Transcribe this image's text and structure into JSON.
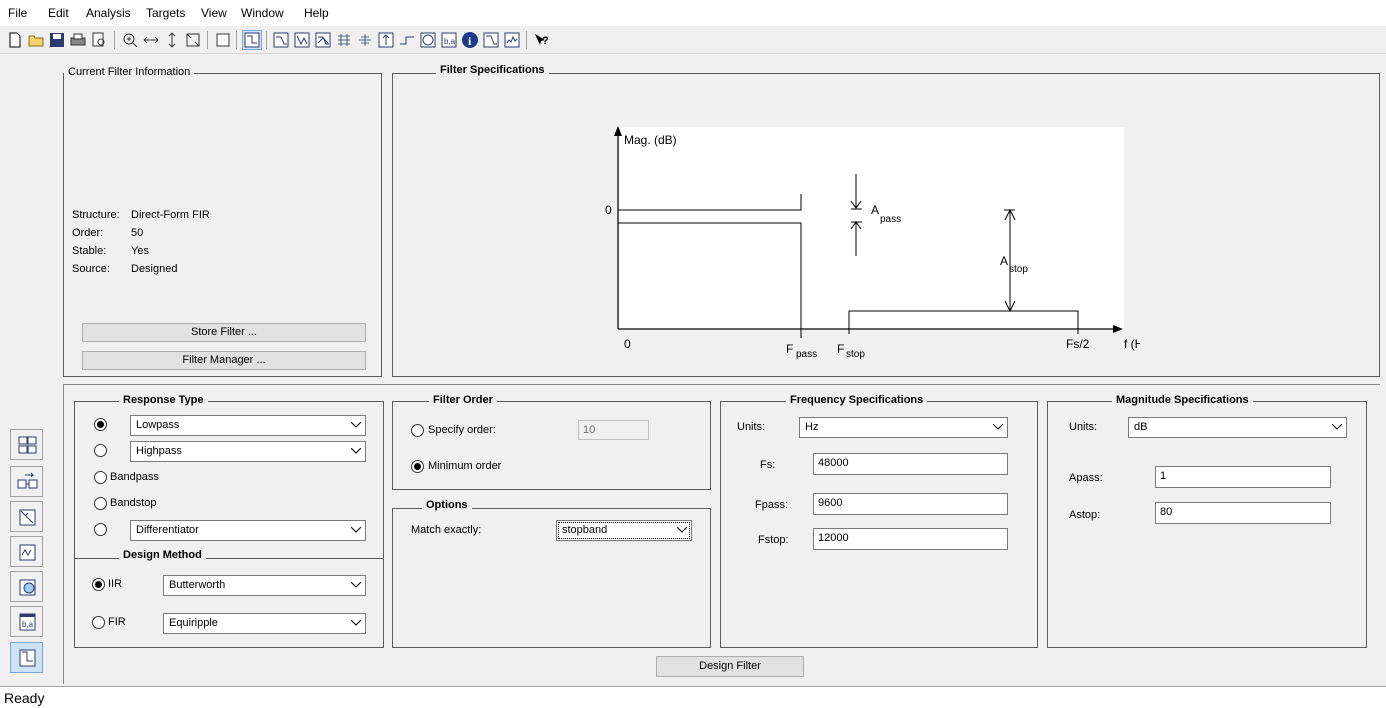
{
  "menu": [
    "File",
    "Edit",
    "Analysis",
    "Targets",
    "View",
    "Window",
    "Help"
  ],
  "toolbar_icons": [
    "new-file-icon",
    "open-folder-icon",
    "save-icon",
    "print-icon",
    "print-preview-icon",
    "zoom-in-icon",
    "zoom-x-icon",
    "zoom-y-icon",
    "full-view-icon",
    "new-figure-icon",
    "filter-specs-icon",
    "magnitude-response-icon",
    "phase-response-icon",
    "mag-phase-icon",
    "group-delay-icon",
    "phase-delay-icon",
    "impulse-response-icon",
    "step-response-icon",
    "pole-zero-icon",
    "coefficients-icon",
    "filter-info-icon",
    "magnitude-estimate-icon",
    "noise-power-icon",
    "whats-this-icon"
  ],
  "current_filter": {
    "title": "Current Filter Information",
    "structure_label": "Structure:",
    "structure_value": "Direct-Form FIR",
    "order_label": "Order:",
    "order_value": "50",
    "stable_label": "Stable:",
    "stable_value": "Yes",
    "source_label": "Source:",
    "source_value": "Designed",
    "store_button": "Store Filter ...",
    "manager_button": "Filter Manager ..."
  },
  "filter_specs": {
    "title": "Filter Specifications",
    "mag_label": "Mag. (dB)",
    "zero_y": "0",
    "zero_x": "0",
    "apass": "A",
    "apass_sub": "pass",
    "astop": "A",
    "astop_sub": "stop",
    "fpass": "F",
    "fpass_sub": "pass",
    "fstop": "F",
    "fstop_sub": "stop",
    "fs2": "Fs/2",
    "f_axis": "f (Hz)"
  },
  "response_type": {
    "title": "Response Type",
    "lowpass": "Lowpass",
    "highpass": "Highpass",
    "bandpass": "Bandpass",
    "bandstop": "Bandstop",
    "differentiator": "Differentiator",
    "selected": "Lowpass"
  },
  "design_method": {
    "title": "Design Method",
    "iir_label": "IIR",
    "iir_value": "Butterworth",
    "fir_label": "FIR",
    "fir_value": "Equiripple",
    "selected": "IIR"
  },
  "filter_order": {
    "title": "Filter Order",
    "specify_label": "Specify order:",
    "specify_value": "10",
    "minimum_label": "Minimum order",
    "selected": "Minimum order"
  },
  "options": {
    "title": "Options",
    "match_label": "Match exactly:",
    "match_value": "stopband"
  },
  "frequency_specs": {
    "title": "Frequency Specifications",
    "units_label": "Units:",
    "units_value": "Hz",
    "fs_label": "Fs:",
    "fs_value": "48000",
    "fpass_label": "Fpass:",
    "fpass_value": "9600",
    "fstop_label": "Fstop:",
    "fstop_value": "12000"
  },
  "magnitude_specs": {
    "title": "Magnitude Specifications",
    "units_label": "Units:",
    "units_value": "dB",
    "apass_label": "Apass:",
    "apass_value": "1",
    "astop_label": "Astop:",
    "astop_value": "80"
  },
  "design_button": "Design Filter",
  "sidebar_icons": [
    "transform-filter-icon",
    "realize-model-icon",
    "pole-zero-editor-icon",
    "multirate-icon",
    "import-filter-icon",
    "quantize-icon",
    "design-filter-icon"
  ],
  "status": "Ready"
}
